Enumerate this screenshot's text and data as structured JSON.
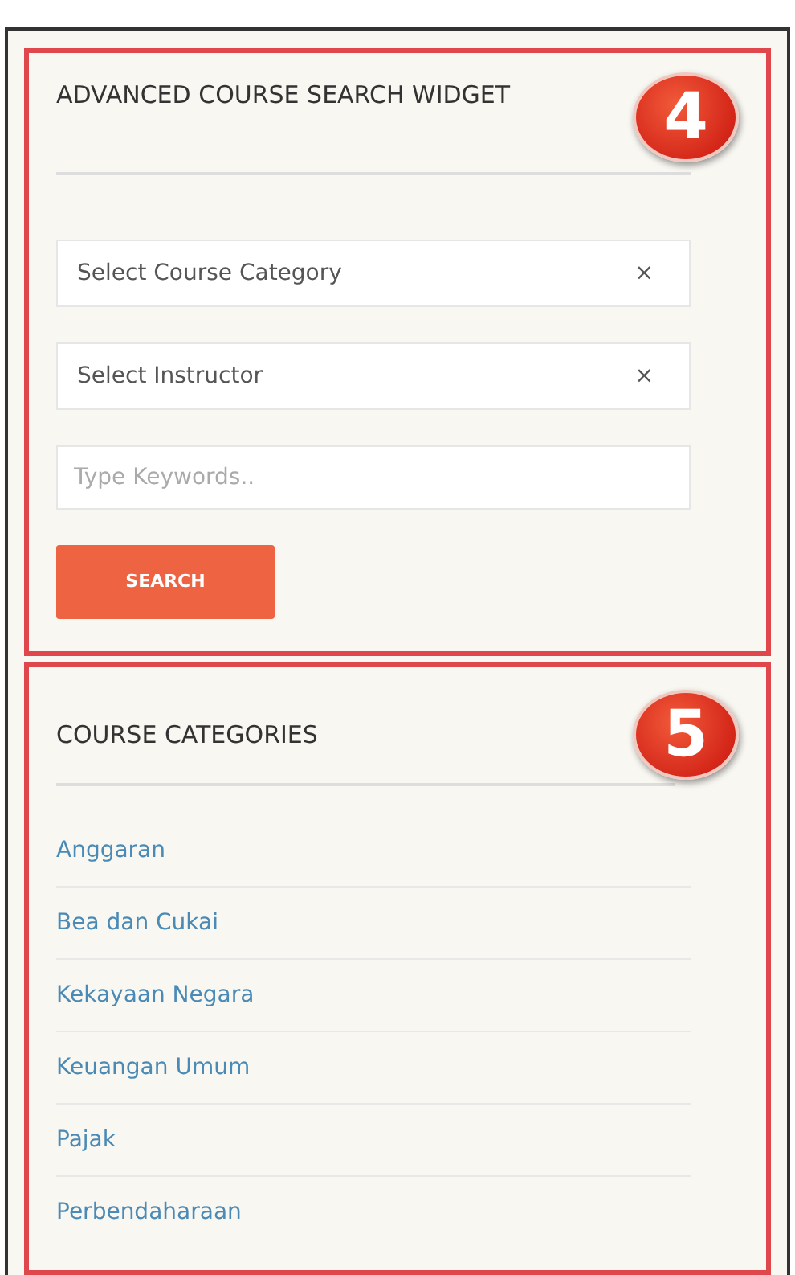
{
  "search_widget": {
    "title": "ADVANCED COURSE SEARCH WIDGET",
    "badge": "4",
    "selects": [
      {
        "placeholder": "Select Course Category",
        "clear": "×"
      },
      {
        "placeholder": "Select Instructor",
        "clear": "×"
      }
    ],
    "keywords": {
      "placeholder": "Type Keywords.."
    },
    "button": "SEARCH"
  },
  "categories": {
    "title": "COURSE CATEGORIES",
    "badge": "5",
    "items": [
      "Anggaran",
      "Bea dan Cukai",
      "Kekayaan Negara",
      "Keuangan Umum",
      "Pajak",
      "Perbendaharaan"
    ]
  }
}
